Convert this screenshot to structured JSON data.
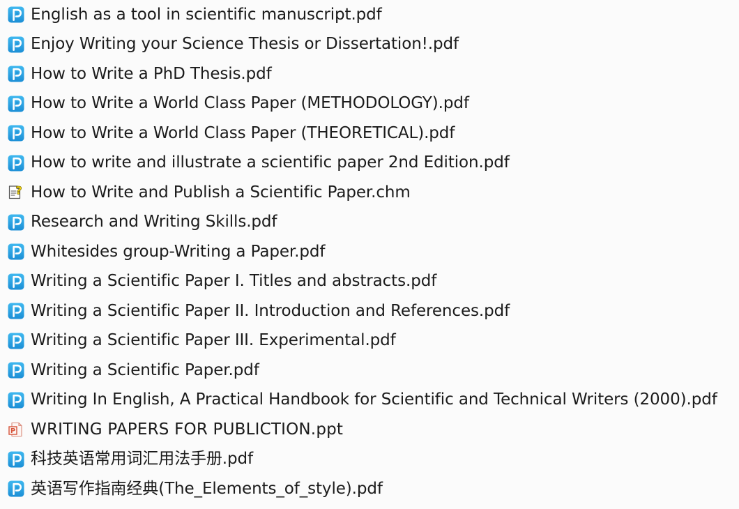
{
  "window": {
    "background_color": "#fbfbfb",
    "text_color": "#1b1b1b"
  },
  "icons": {
    "pdf": {
      "name": "pdf-file-icon",
      "glyph": "P",
      "color_top": "#3fb8ef",
      "color_bottom": "#1c8fd6",
      "glyph_color": "#ffffff"
    },
    "chm": {
      "name": "chm-help-file-icon",
      "glyph": "?",
      "page_color": "#ffffff",
      "line_color": "#555555",
      "glyph_color": "#f5d516"
    },
    "ppt": {
      "name": "powerpoint-file-icon",
      "glyph": "P",
      "page_color": "#fdf6f4",
      "outline_color": "#d98a7a",
      "glyph_color": "#d6543a"
    }
  },
  "files": [
    {
      "name": "English as a tool in scientific manuscript.pdf",
      "type": "pdf",
      "script": "latin"
    },
    {
      "name": "Enjoy Writing your Science Thesis or Dissertation!.pdf",
      "type": "pdf",
      "script": "latin"
    },
    {
      "name": "How to Write a PhD Thesis.pdf",
      "type": "pdf",
      "script": "latin"
    },
    {
      "name": "How to Write a World Class Paper (METHODOLOGY).pdf",
      "type": "pdf",
      "script": "latin"
    },
    {
      "name": "How to Write a World Class Paper (THEORETICAL).pdf",
      "type": "pdf",
      "script": "latin"
    },
    {
      "name": "How to write and illustrate a scientific paper 2nd Edition.pdf",
      "type": "pdf",
      "script": "latin"
    },
    {
      "name": "How to Write and Publish a Scientific Paper.chm",
      "type": "chm",
      "script": "latin"
    },
    {
      "name": "Research and Writing Skills.pdf",
      "type": "pdf",
      "script": "latin"
    },
    {
      "name": "Whitesides group-Writing a Paper.pdf",
      "type": "pdf",
      "script": "latin"
    },
    {
      "name": "Writing a Scientific Paper I. Titles and abstracts.pdf",
      "type": "pdf",
      "script": "latin"
    },
    {
      "name": "Writing a Scientific Paper II. Introduction and References.pdf",
      "type": "pdf",
      "script": "latin"
    },
    {
      "name": "Writing a Scientific Paper III. Experimental.pdf",
      "type": "pdf",
      "script": "latin"
    },
    {
      "name": "Writing a Scientific Paper.pdf",
      "type": "pdf",
      "script": "latin"
    },
    {
      "name": "Writing In English, A Practical Handbook for Scientific and Technical Writers (2000).pdf",
      "type": "pdf",
      "script": "latin"
    },
    {
      "name": "WRITING PAPERS FOR PUBLICTION.ppt",
      "type": "ppt",
      "script": "latin-caps"
    },
    {
      "name": "科技英语常用词汇用法手册.pdf",
      "type": "pdf",
      "script": "cjk"
    },
    {
      "name": "英语写作指南经典(The_Elements_of_style).pdf",
      "type": "pdf",
      "script": "cjk"
    }
  ]
}
